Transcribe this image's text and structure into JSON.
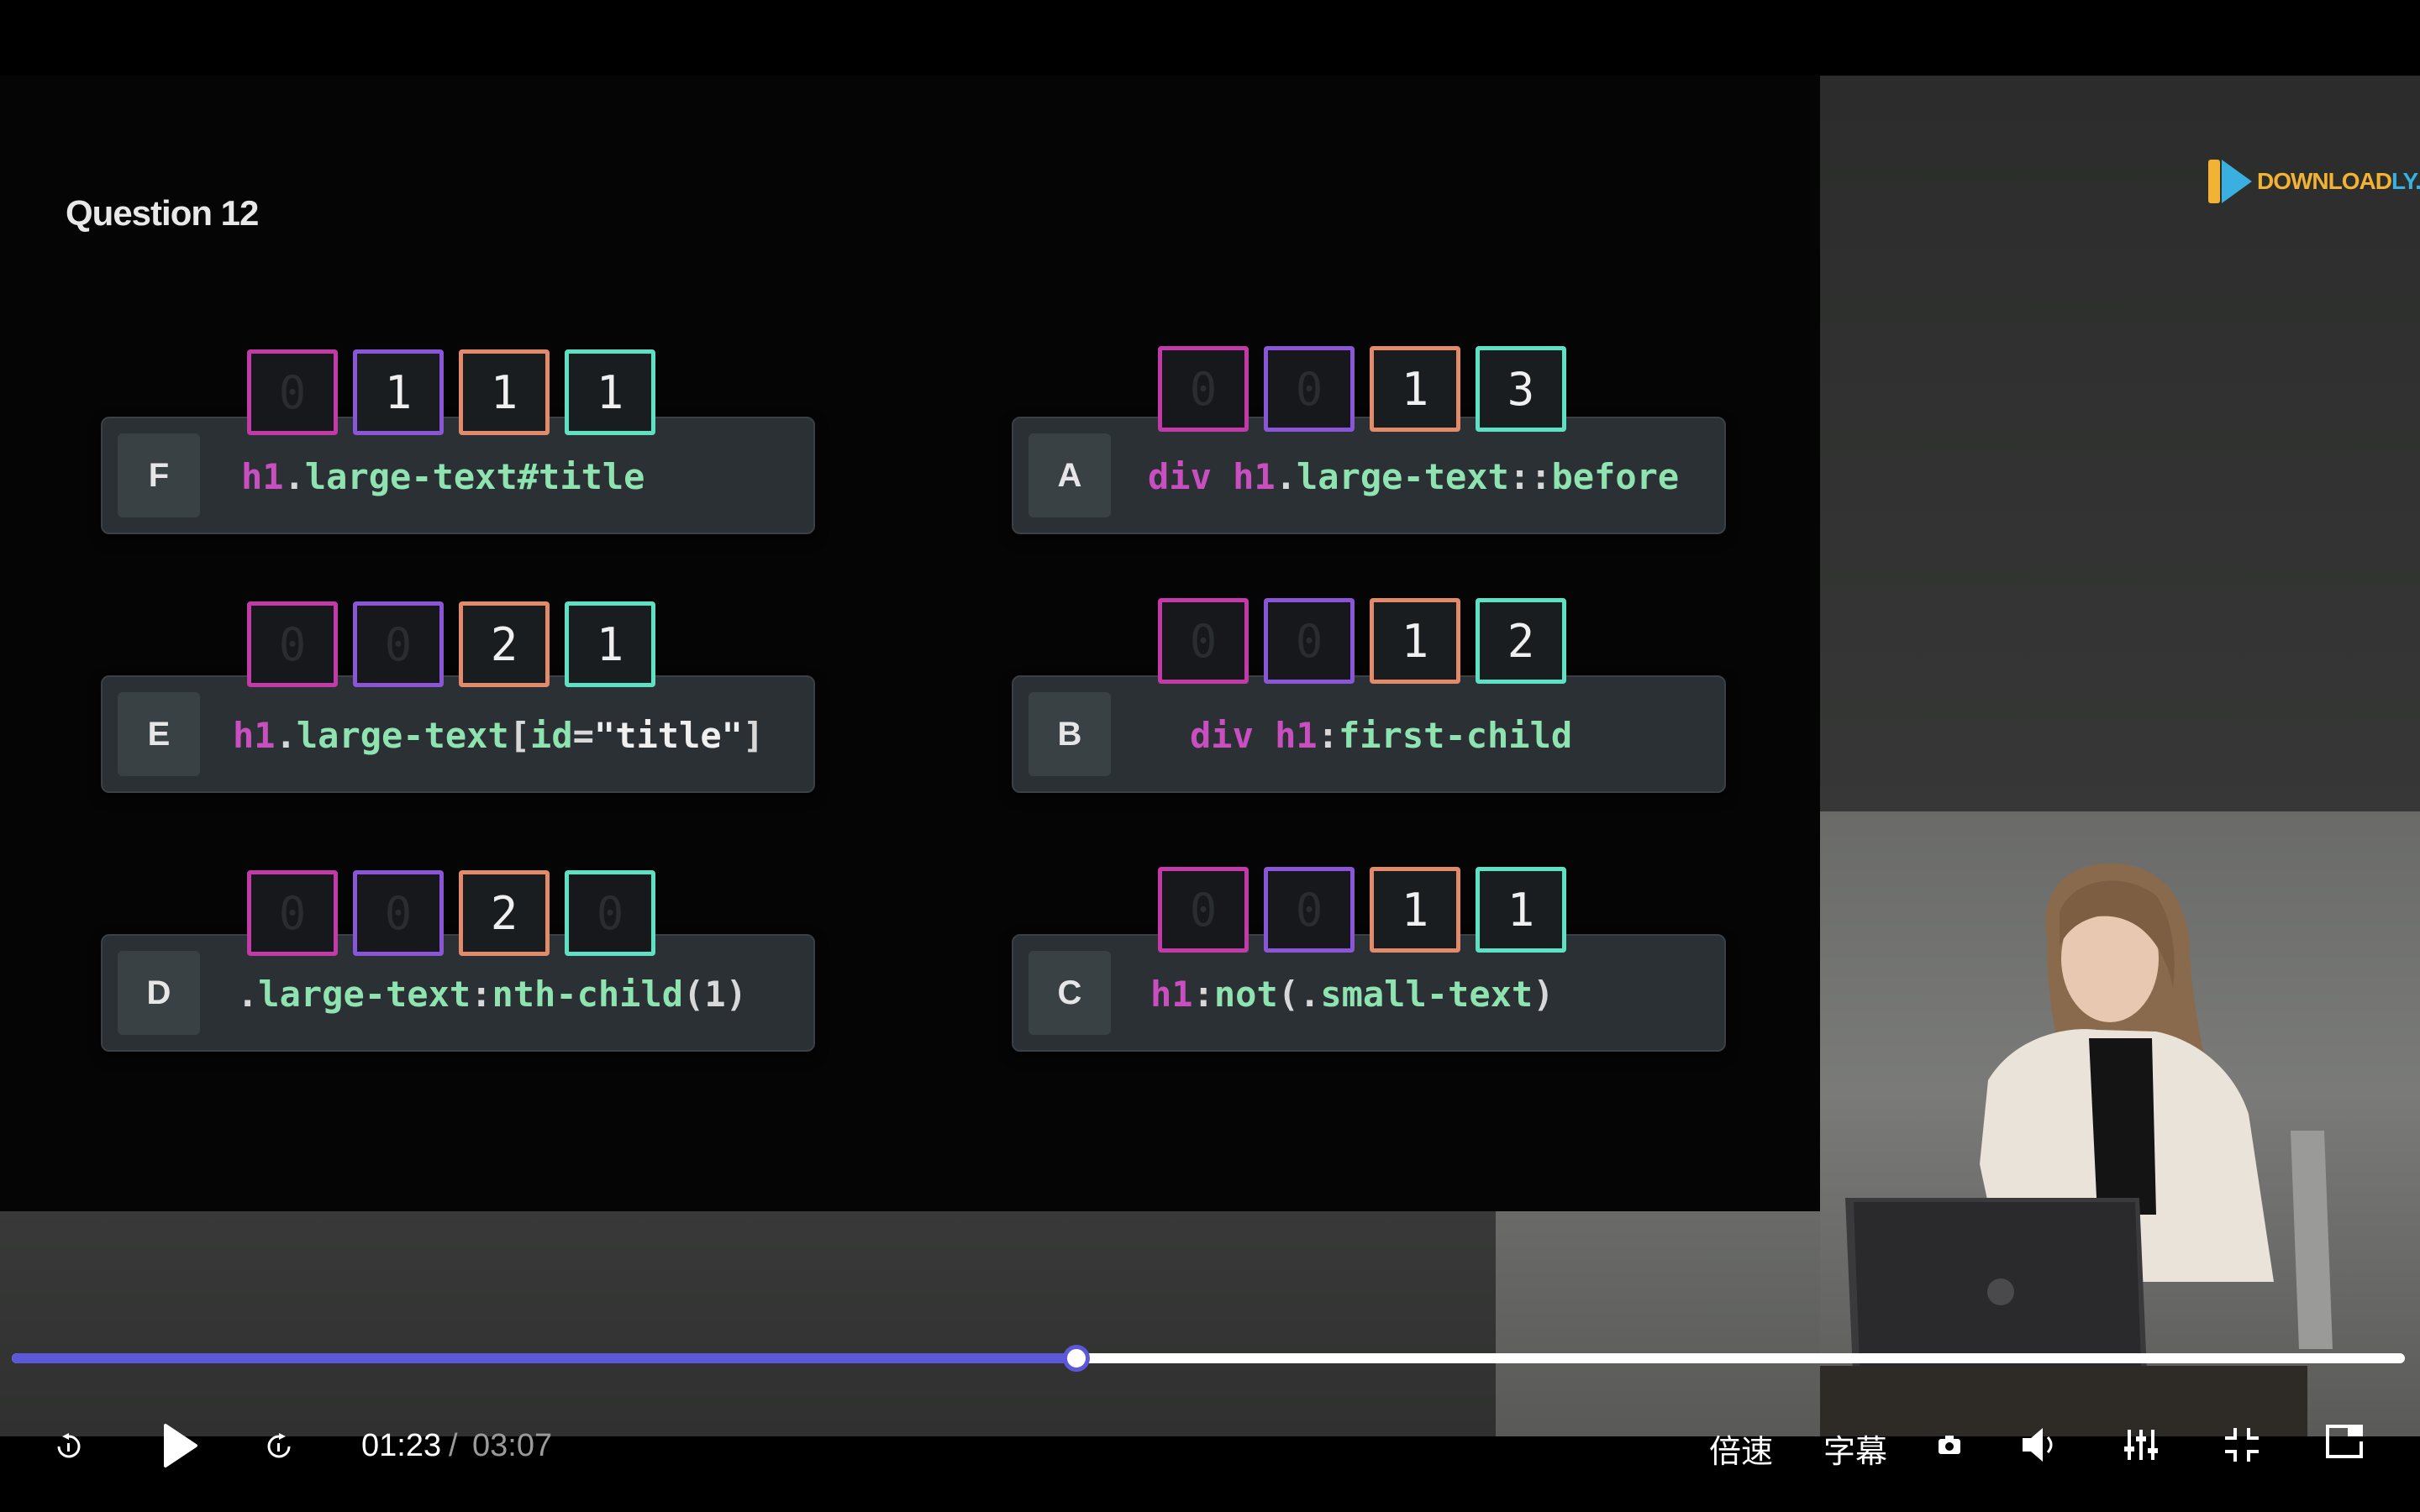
{
  "slide": {
    "title": "Question 12",
    "cards": [
      {
        "letter": "F",
        "code": [
          [
            "tag",
            "h1"
          ],
          [
            "punc",
            "."
          ],
          [
            "sel",
            "large-text"
          ],
          [
            "sel",
            "#title"
          ]
        ],
        "spec": [
          "0",
          "1",
          "1",
          "1"
        ]
      },
      {
        "letter": "A",
        "code": [
          [
            "tag",
            "div h1"
          ],
          [
            "punc",
            "."
          ],
          [
            "sel",
            "large-text"
          ],
          [
            "punc",
            "::"
          ],
          [
            "sel",
            "before"
          ]
        ],
        "spec": [
          "0",
          "0",
          "1",
          "3"
        ]
      },
      {
        "letter": "E",
        "code": [
          [
            "tag",
            "h1"
          ],
          [
            "punc",
            "."
          ],
          [
            "sel",
            "large-text"
          ],
          [
            "punc",
            "["
          ],
          [
            "sel",
            "id"
          ],
          [
            "punc",
            "="
          ],
          [
            "str",
            "\"title\""
          ],
          [
            "punc",
            "]"
          ]
        ],
        "spec": [
          "0",
          "0",
          "2",
          "1"
        ]
      },
      {
        "letter": "B",
        "code": [
          [
            "tag",
            "div h1"
          ],
          [
            "punc",
            ":"
          ],
          [
            "sel",
            "first-child"
          ]
        ],
        "spec": [
          "0",
          "0",
          "1",
          "2"
        ]
      },
      {
        "letter": "D",
        "code": [
          [
            "punc",
            "."
          ],
          [
            "sel",
            "large-text"
          ],
          [
            "punc",
            ":"
          ],
          [
            "sel",
            "nth-child"
          ],
          [
            "punc",
            "(1)"
          ]
        ],
        "spec": [
          "0",
          "0",
          "2",
          "0"
        ]
      },
      {
        "letter": "C",
        "code": [
          [
            "tag",
            "h1"
          ],
          [
            "punc",
            ":"
          ],
          [
            "sel",
            "not"
          ],
          [
            "punc",
            "(."
          ],
          [
            "sel",
            "small-text"
          ],
          [
            "punc",
            ")"
          ]
        ],
        "spec": [
          "0",
          "0",
          "1",
          "1"
        ]
      }
    ]
  },
  "watermark": {
    "part1": "DOWNLOAD",
    "part2": "LY.IR"
  },
  "player": {
    "current_time": "01:23",
    "separator": "/",
    "duration": "03:07",
    "progress_fraction": 0.445,
    "speed_label": "倍速",
    "subtitle_label": "字幕",
    "accent": "#5b59d8",
    "icons": [
      "rewind-icon",
      "play-icon",
      "forward-icon",
      "screenshot-icon",
      "volume-icon",
      "settings-icon",
      "exit-fullscreen-icon",
      "pip-icon"
    ]
  }
}
